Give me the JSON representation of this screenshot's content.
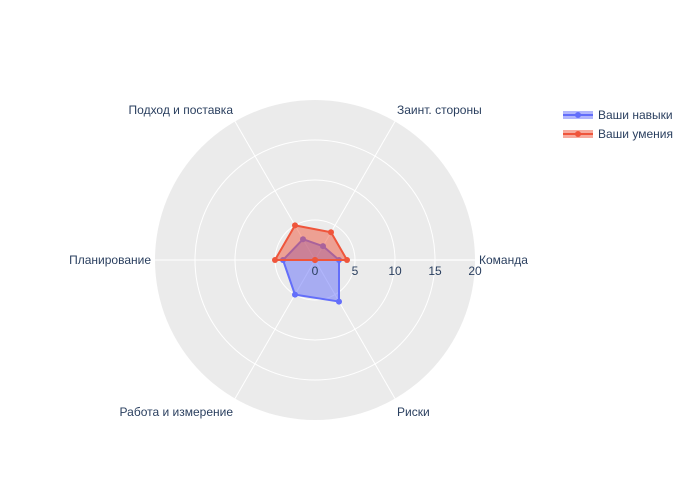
{
  "chart_data": {
    "type": "radar",
    "categories": [
      "Команда",
      "Заинт. стороны",
      "Подход и поставка",
      "Планирование",
      "Работа и измерение",
      "Риски"
    ],
    "radial_range": [
      0,
      20
    ],
    "radial_ticks": [
      0,
      5,
      10,
      15,
      20
    ],
    "series": [
      {
        "name": "Ваши навыки",
        "values": [
          3,
          2,
          3,
          4,
          5,
          6
        ],
        "color": "#636efa"
      },
      {
        "name": "Ваши умения",
        "values": [
          4,
          4,
          5,
          5,
          0,
          0
        ],
        "color": "#ef553b"
      }
    ],
    "grid": true,
    "legend_position": "top-right"
  }
}
